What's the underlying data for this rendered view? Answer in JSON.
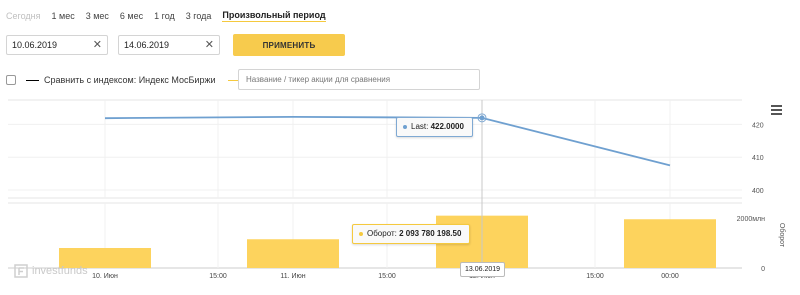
{
  "periods": [
    {
      "label": "Сегодня",
      "state": "disabled"
    },
    {
      "label": "1 мес",
      "state": "normal"
    },
    {
      "label": "3 мес",
      "state": "normal"
    },
    {
      "label": "6 мес",
      "state": "normal"
    },
    {
      "label": "1 год",
      "state": "normal"
    },
    {
      "label": "3 года",
      "state": "normal"
    },
    {
      "label": "Произвольный период",
      "state": "active"
    }
  ],
  "date_from": "10.06.2019",
  "date_to": "14.06.2019",
  "apply_label": "ПРИМЕНИТЬ",
  "compare": {
    "checkbox_label": "Сравнить с индексом: Индекс МосБиржи",
    "ticker_placeholder": "Название / тикер акции для сравнения"
  },
  "colors": {
    "accent": "#f7cb4d",
    "price_line": "#6fa0d0",
    "volume_bar": "#fdd35d"
  },
  "tooltips": {
    "last_label": "Last:",
    "last_value": "422.0000",
    "volume_label": "Оборот:",
    "volume_value": "2 093 780 198.50",
    "date": "13.06.2019"
  },
  "watermark": "investfunds",
  "chart_data": [
    {
      "type": "line",
      "name": "price",
      "x_ticks": [
        "10. Июн",
        "15:00",
        "11. Июн",
        "15:00",
        "12. Июн",
        "15:00",
        "00:00"
      ],
      "x": [
        "10.06.2019",
        "11.06.2019",
        "12.06.2019",
        "13.06.2019",
        "14.06.2019"
      ],
      "y": [
        421.9,
        422.3,
        422.0,
        422.0,
        407.5
      ],
      "y_ticks": [
        "420",
        "410",
        "400"
      ],
      "ylim": [
        400,
        425
      ],
      "grid": true
    },
    {
      "type": "bar",
      "name": "volume",
      "categories": [
        "10.06.2019",
        "11.06.2019",
        "12.06.2019",
        "13.06.2019",
        "14.06.2019"
      ],
      "values": [
        800,
        1150,
        0,
        2093.78,
        1950
      ],
      "ylabel": "Оборот",
      "y_ticks": [
        "2000млн",
        "0"
      ],
      "ylim": [
        0,
        2600
      ]
    }
  ]
}
